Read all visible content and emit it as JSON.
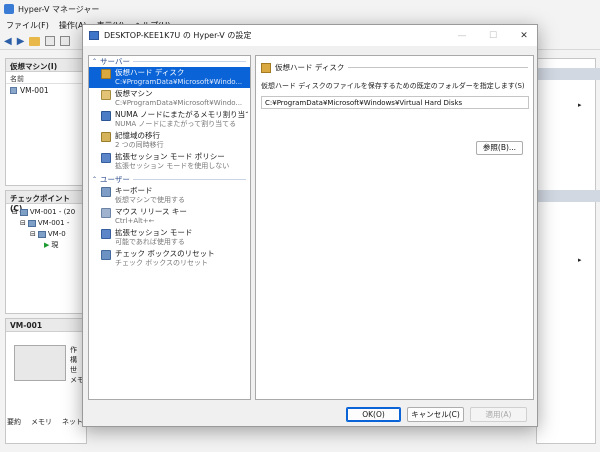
{
  "bg": {
    "title": "Hyper-V マネージャー",
    "menu": [
      "ファイル(F)",
      "操作(A)",
      "表示(V)",
      "ヘルプ(H)"
    ],
    "vm_panel": {
      "title": "仮想マシン(I)",
      "col_name": "名前",
      "vms": [
        "VM-001"
      ]
    },
    "checkpoint_panel": {
      "title": "チェックポイント(C)",
      "nodes": [
        "VM-001 - (20",
        "VM-001 -",
        "VM-0",
        "現"
      ]
    },
    "detail_panel": {
      "title": "VM-001",
      "lines": [
        "作",
        "構",
        "世",
        "メモ"
      ]
    },
    "tabs": [
      "要約",
      "メモリ",
      "ネット"
    ]
  },
  "dialog": {
    "title": "DESKTOP-KEE1K7U の Hyper-V の設定",
    "sections": {
      "server": "サーバー",
      "user": "ユーザー"
    },
    "server_items": [
      {
        "label": "仮想ハード ディスク",
        "sub": "C:¥ProgramData¥Microsoft¥Windo..."
      },
      {
        "label": "仮想マシン",
        "sub": "C:¥ProgramData¥Microsoft¥Windo..."
      },
      {
        "label": "NUMA ノードにまたがるメモリ割り当て",
        "sub": "NUMA ノードにまたがって割り当てる"
      },
      {
        "label": "記憶域の移行",
        "sub": "2 つの同時移行"
      },
      {
        "label": "拡張セッション モード ポリシー",
        "sub": "拡張セッション モードを使用しない"
      }
    ],
    "user_items": [
      {
        "label": "キーボード",
        "sub": "仮想マシンで使用する"
      },
      {
        "label": "マウス リリース キー",
        "sub": "Ctrl+Alt+←"
      },
      {
        "label": "拡張セッション モード",
        "sub": "可能であれば使用する"
      },
      {
        "label": "チェック ボックスのリセット",
        "sub": "チェック ボックスのリセット"
      }
    ],
    "content": {
      "heading": "仮想ハード ディスク",
      "description": "仮想ハード ディスクのファイルを保存するための既定のフォルダーを指定します(S)",
      "path": "C:¥ProgramData¥Microsoft¥Windows¥Virtual Hard Disks",
      "browse": "参照(B)..."
    },
    "buttons": {
      "ok": "OK(O)",
      "cancel": "キャンセル(C)",
      "apply": "適用(A)"
    }
  }
}
